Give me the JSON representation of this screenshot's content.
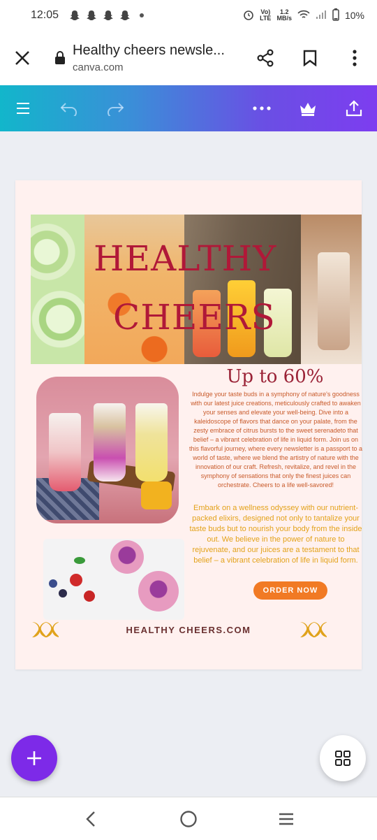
{
  "status": {
    "time": "12:05",
    "network_top": "Vo)",
    "network_bottom": "LTE",
    "speed_top": "1.2",
    "speed_bottom": "MB/s",
    "battery": "10%"
  },
  "browser": {
    "title": "Healthy cheers newsle...",
    "domain": "canva.com"
  },
  "design": {
    "hero_title_line1": "HEALTHY",
    "hero_title_line2": "CHEERS",
    "headline": "Up to 60%",
    "paragraph_small": "Indulge your taste buds in a symphony of nature's goodness with our latest juice creations, meticulously crafted to awaken your senses and elevate your well-being. Dive into a kaleidoscope of flavors that dance on your palate, from the zesty embrace of citrus bursts to the sweet serenadeto that belief – a vibrant celebration of life in liquid form. Join us on this flavorful journey, where every newsletter is a passport to a world of taste, where we blend the artistry of nature with the innovation of our craft. Refresh, revitalize, and revel in the symphony of sensations that only the finest juices can orchestrate. Cheers to a life well-savored!",
    "paragraph_large": "Embark on a wellness odyssey with our nutrient-packed elixirs, designed not only to tantalize your taste buds but to nourish your body from the inside out. We believe in the power of nature to rejuvenate, and our juices are a testament to that belief – a vibrant celebration of life in liquid form.",
    "order_button": "ORDER NOW",
    "footer": "HEALTHY CHEERS.COM"
  },
  "colors": {
    "accent_purple": "#7d2ae8",
    "title_red": "#b01838",
    "order_orange": "#f17a24",
    "flourish_gold": "#e3a21a"
  }
}
